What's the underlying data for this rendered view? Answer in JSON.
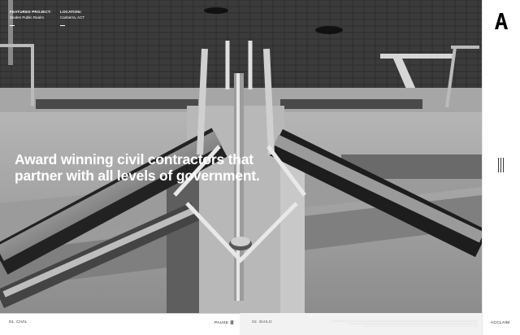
{
  "featured": {
    "label": "FEATURED PROJECT:",
    "value": "Woden Public Realm"
  },
  "location": {
    "label": "LOCATION:",
    "value": "Canberra, ACT"
  },
  "headline": {
    "line1": "Award winning civil contractors that",
    "line2": "partner with all levels of government."
  },
  "slides": [
    {
      "label": "01. CIVIL"
    },
    {
      "label": "02. BUILD"
    }
  ],
  "controls": {
    "pause_label": "PAUSE"
  },
  "sidebar": {
    "brand_label": "ACCLAIM"
  },
  "icons": {
    "logo": "acclaim-a-logo",
    "menu": "vertical-bars-menu-icon",
    "pause": "pause-icon"
  },
  "colors": {
    "background": "#ffffff",
    "text": "#222222",
    "hero_text": "#ffffff",
    "inactive_tab": "#f2f2f2"
  }
}
